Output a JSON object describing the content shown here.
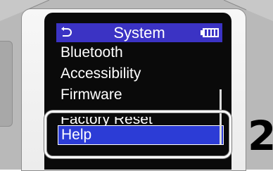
{
  "header": {
    "title": "System",
    "back_icon": "return-arrow-icon",
    "battery_icon": "battery-full-icon"
  },
  "menu": {
    "items": [
      {
        "label": "Bluetooth"
      },
      {
        "label": "Accessibility"
      },
      {
        "label": "Firmware"
      },
      {
        "label": "Factory Reset"
      },
      {
        "label": "Help",
        "selected": true
      }
    ]
  },
  "callout": {
    "step_number": "2"
  },
  "colors": {
    "header_bg": "#3b33c4",
    "selected_bg": "#2c3cd6",
    "screen_bg": "#0a0a0a",
    "text": "#ffffff"
  }
}
